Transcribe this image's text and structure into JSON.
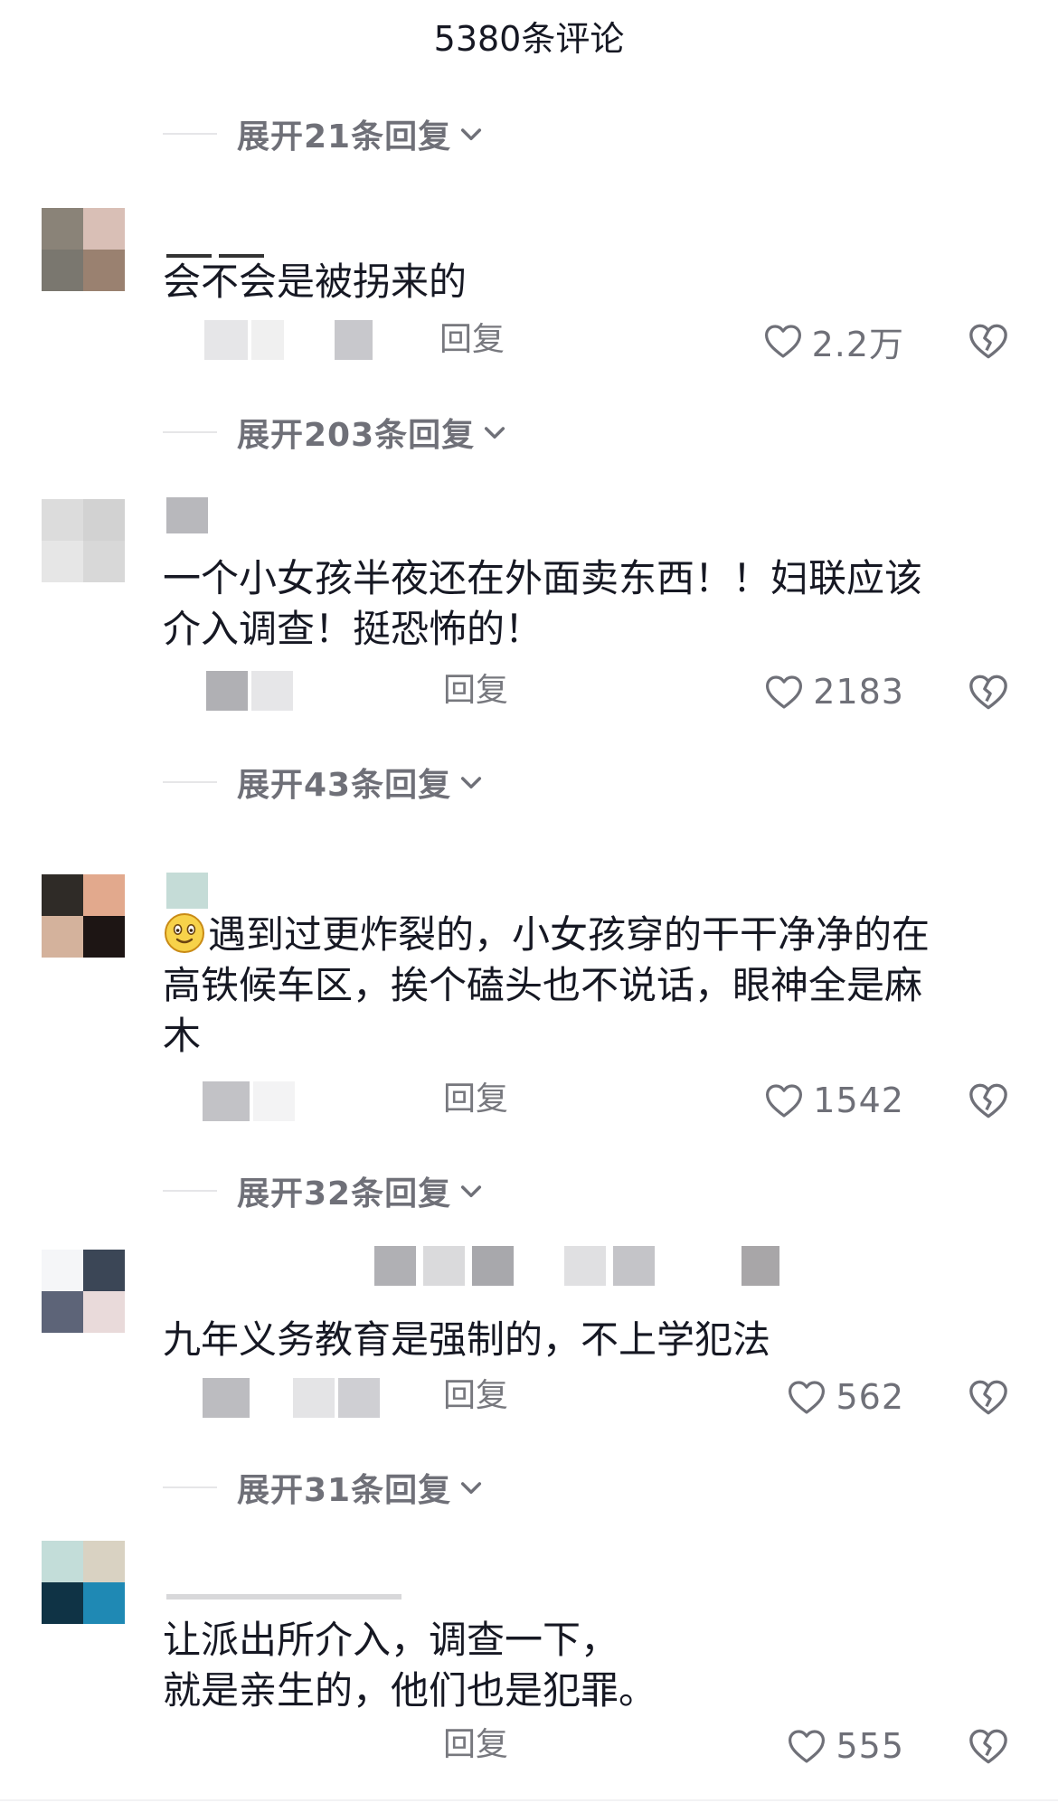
{
  "header": {
    "title": "5380条评论"
  },
  "expand_rows": [
    "展开21条回复",
    "展开203条回复",
    "展开43条回复",
    "展开32条回复",
    "展开31条回复"
  ],
  "comments": [
    {
      "text": "会不会是被拐来的",
      "reply_label": "回复",
      "likes": "2.2万",
      "avatar_colors": [
        "#8a8378",
        "#d9bfb6",
        "#7a776f",
        "#9a8170"
      ]
    },
    {
      "text": "一个小女孩半夜还在外面卖东西！！妇联应该\n介入调查！挺恐怖的！",
      "reply_label": "回复",
      "likes": "2183",
      "avatar_colors": [
        "#dcdcdc",
        "#d2d2d2",
        "#e6e6e6",
        "#d8d8d8"
      ]
    },
    {
      "text": "遇到过更炸裂的，小女孩穿的干干净净的在\n高铁候车区，挨个磕头也不说话，眼神全是麻\n木",
      "reply_label": "回复",
      "likes": "1542",
      "avatar_colors": [
        "#2f2b27",
        "#e2a98d",
        "#d4b29c",
        "#1d1514"
      ]
    },
    {
      "text": "九年义务教育是强制的，不上学犯法",
      "reply_label": "回复",
      "likes": "562",
      "avatar_colors": [
        "#f5f6f8",
        "#3b4656",
        "#5d6478",
        "#e9dada"
      ]
    },
    {
      "text": "让派出所介入，调查一下，\n就是亲生的，他们也是犯罪。",
      "reply_label": "回复",
      "likes": "555",
      "avatar_colors": [
        "#c3ddd9",
        "#d9d2c2",
        "#0f3345",
        "#1f89b4"
      ]
    }
  ],
  "colors": {
    "text_primary": "#161823",
    "text_secondary": "#6f7078",
    "divider": "#e6e6e8"
  },
  "icons": {
    "like": "heart-outline-icon",
    "dislike": "broken-heart-icon",
    "expand": "chevron-down-icon",
    "emoji": "smiling-face-emoji"
  }
}
